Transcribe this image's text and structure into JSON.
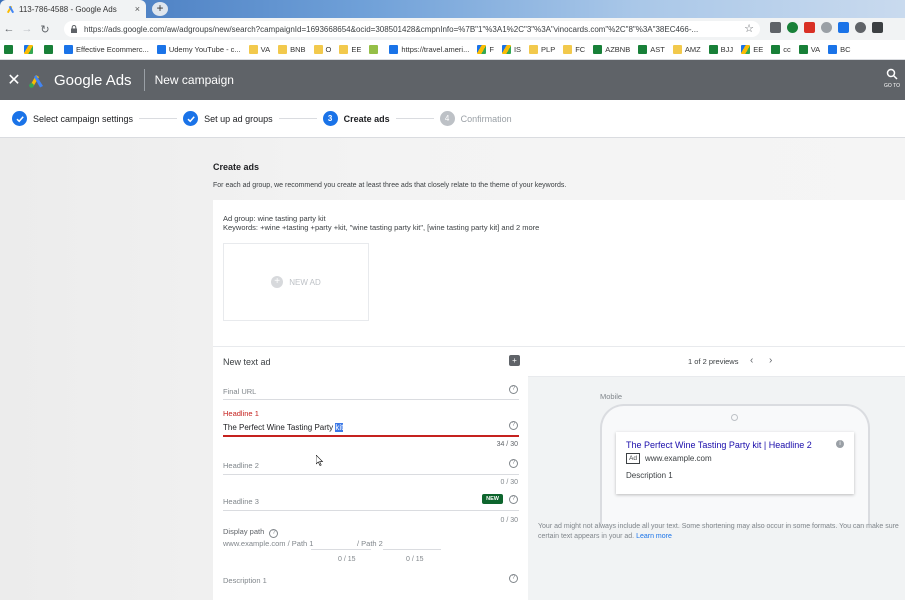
{
  "browser": {
    "tab_title": "113-786-4588 - Google Ads",
    "url": "https://ads.google.com/aw/adgroups/new/search?campaignId=1693668654&ocid=308501428&cmpnInfo=%7B\"1\"%3A1%2C\"3\"%3A\"vinocards.com\"%2C\"8\"%3A\"38EC466-...",
    "bookmarks": [
      {
        "label": "",
        "icon": "sheets-icon"
      },
      {
        "label": "",
        "icon": "drive-icon"
      },
      {
        "label": "",
        "icon": "sheets-icon"
      },
      {
        "label": "Effective Ecommerc...",
        "icon": "doc-icon"
      },
      {
        "label": "Udemy YouTube - c...",
        "icon": "video-icon"
      },
      {
        "label": "VA",
        "icon": "folder-icon"
      },
      {
        "label": "BNB",
        "icon": "folder-icon"
      },
      {
        "label": "O",
        "icon": "folder-icon"
      },
      {
        "label": "EE",
        "icon": "folder-icon"
      },
      {
        "label": "",
        "icon": "shopify-icon"
      },
      {
        "label": "https://travel.ameri...",
        "icon": "page-icon"
      },
      {
        "label": "F",
        "icon": "drive-icon"
      },
      {
        "label": "IS",
        "icon": "drive-icon"
      },
      {
        "label": "PLP",
        "icon": "folder-icon"
      },
      {
        "label": "FC",
        "icon": "folder-icon"
      },
      {
        "label": "AZBNB",
        "icon": "sheets-icon"
      },
      {
        "label": "AST",
        "icon": "sheets-icon"
      },
      {
        "label": "AMZ",
        "icon": "folder-icon"
      },
      {
        "label": "BJJ",
        "icon": "sheets-icon"
      },
      {
        "label": "EE",
        "icon": "drive-icon"
      },
      {
        "label": "cc",
        "icon": "sheets-icon"
      },
      {
        "label": "VA",
        "icon": "sheets-icon"
      },
      {
        "label": "BC",
        "icon": "page-icon"
      }
    ]
  },
  "header": {
    "brand": "Google Ads",
    "title": "New campaign",
    "goto_label": "GO TO"
  },
  "stepper": {
    "steps": [
      {
        "num": "",
        "label": "Select campaign settings",
        "state": "done"
      },
      {
        "num": "",
        "label": "Set up ad groups",
        "state": "done"
      },
      {
        "num": "3",
        "label": "Create ads",
        "state": "active"
      },
      {
        "num": "4",
        "label": "Confirmation",
        "state": "future"
      }
    ]
  },
  "create_ads": {
    "title": "Create ads",
    "description": "For each ad group, we recommend you create at least three ads that closely relate to the theme of your keywords.",
    "ad_group_label": "Ad group:",
    "ad_group_name": "wine tasting party kit",
    "keywords_label": "Keywords:",
    "keywords": "+wine +tasting +party +kit, \"wine tasting party kit\", [wine tasting party kit] and 2 more",
    "new_ad_label": "NEW AD"
  },
  "editor": {
    "title": "New text ad",
    "final_url_label": "Final URL",
    "headline1_label": "Headline 1",
    "headline1_value": "The Perfect Wine Tasting Party ",
    "headline1_selected": "kit",
    "headline1_counter": "34 / 30",
    "headline2_label": "Headline 2",
    "headline2_counter": "0 / 30",
    "headline3_label": "Headline 3",
    "headline3_badge": "NEW",
    "headline3_counter": "0 / 30",
    "display_path_label": "Display path",
    "display_path_base": "www.example.com / Path 1",
    "display_path_2": "/ Path 2",
    "path1_counter": "0 / 15",
    "path2_counter": "0 / 15",
    "description1_label": "Description 1"
  },
  "preview": {
    "count": "1 of 2 previews",
    "device_label": "Mobile",
    "ad_headline": "The Perfect Wine Tasting Party kit | Headline 2",
    "ad_badge": "Ad",
    "ad_url": "www.example.com",
    "ad_description": "Description 1",
    "note": "Your ad might not always include all your text. Some shortening may also occur in some formats. You can make sure certain text appears in your ad.",
    "learn_more": "Learn more"
  }
}
